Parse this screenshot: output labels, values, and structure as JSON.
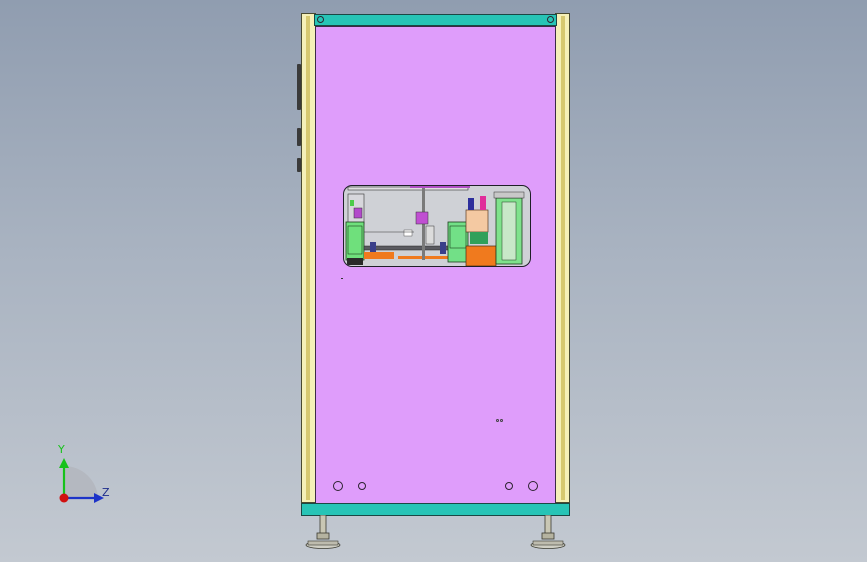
{
  "viewport": {
    "title": "",
    "background_top": "#909db0",
    "background_bottom": "#c3c9d1"
  },
  "triad": {
    "y_label": "Y",
    "z_label": "Z",
    "y_color": "#17c21b",
    "z_color": "#1d33c8",
    "origin_color": "#d01010"
  },
  "model": {
    "panel_color": "#df9dfb",
    "frame_color": "#f5f0b8",
    "rail_color": "#27c4b6",
    "foot_color": "#b9b7a8"
  },
  "icons": {
    "triad": "coordinate-triad-icon",
    "hole": "mounting-hole-icon"
  }
}
